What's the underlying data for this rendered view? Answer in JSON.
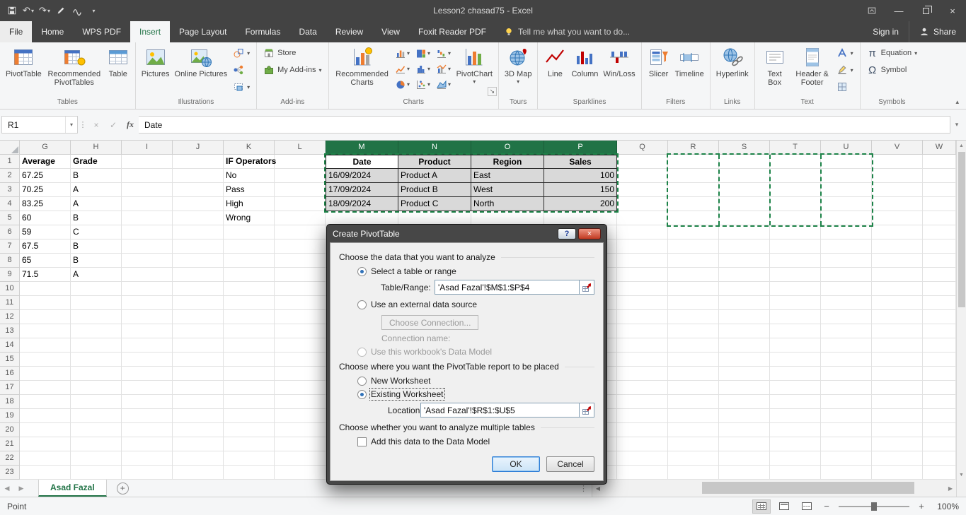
{
  "colors": {
    "accent_green": "#217346",
    "titlebar_bg": "#434343",
    "ribbon_bg": "#f5f6f7",
    "selected_header_bg": "#217346",
    "selection_fill": "#d9d9d9",
    "marching_ants_green": "#1d8348"
  },
  "icons": {
    "dropdown": "▾",
    "undo": "↶",
    "redo": "↷",
    "minimize": "—",
    "close": "×",
    "check": "✓",
    "cross": "×",
    "help": "?",
    "left": "◀",
    "right": "▶",
    "up": "▲",
    "down": "▼",
    "plus": "+",
    "minus": "−",
    "pi": "π",
    "omega": "Ω",
    "dots": "⋮",
    "launcher": "↘",
    "collapse": "▴"
  },
  "titlebar": {
    "title": "Lesson2 chasad75 - Excel"
  },
  "tabs": {
    "file": "File",
    "items": [
      "Home",
      "WPS PDF",
      "Insert",
      "Page Layout",
      "Formulas",
      "Data",
      "Review",
      "View",
      "Foxit Reader PDF"
    ],
    "active": "Insert",
    "tell_me": "Tell me what you want to do...",
    "sign_in": "Sign in",
    "share": "Share"
  },
  "ribbon": {
    "groups": {
      "tables": {
        "label": "Tables",
        "pivottable": "PivotTable",
        "recommended": "Recommended PivotTables",
        "table": "Table"
      },
      "illustrations": {
        "label": "Illustrations",
        "pictures": "Pictures",
        "online_pictures": "Online Pictures"
      },
      "addins": {
        "label": "Add-ins",
        "store": "Store",
        "my_addins": "My Add-ins"
      },
      "charts": {
        "label": "Charts",
        "recommended": "Recommended Charts",
        "pivotchart": "PivotChart"
      },
      "tours": {
        "label": "Tours",
        "map": "3D Map"
      },
      "sparklines": {
        "label": "Sparklines",
        "line": "Line",
        "column": "Column",
        "winloss": "Win/Loss"
      },
      "filters": {
        "label": "Filters",
        "slicer": "Slicer",
        "timeline": "Timeline"
      },
      "links": {
        "label": "Links",
        "hyperlink": "Hyperlink"
      },
      "text": {
        "label": "Text",
        "textbox": "Text Box",
        "headerfooter": "Header & Footer"
      },
      "symbols": {
        "label": "Symbols",
        "equation": "Equation",
        "symbol": "Symbol"
      }
    }
  },
  "formula_bar": {
    "name_box": "R1",
    "fx": "fx",
    "content": "Date"
  },
  "grid": {
    "columns": [
      "G",
      "H",
      "I",
      "J",
      "K",
      "L",
      "M",
      "N",
      "O",
      "P",
      "Q",
      "R",
      "S",
      "T",
      "U",
      "V",
      "W"
    ],
    "row_count": 23,
    "selected_columns": [
      "M",
      "N",
      "O",
      "P"
    ],
    "source_range": "M1:P4",
    "destination_range": "R1:U5",
    "cells": {
      "G1": "Average",
      "H1": "Grade",
      "K1": "IF Operators",
      "G2": "67.25",
      "H2": "B",
      "K2": "No",
      "G3": "70.25",
      "H3": "A",
      "K3": "Pass",
      "G4": "83.25",
      "H4": "A",
      "K4": "High",
      "G5": "60",
      "H5": "B",
      "K5": "Wrong",
      "G6": "59",
      "H6": "C",
      "G7": "67.5",
      "H7": "B",
      "G8": "65",
      "H8": "B",
      "G9": "71.5",
      "H9": "A",
      "M1": "Date",
      "N1": "Product",
      "O1": "Region",
      "P1": "Sales",
      "M2": "16/09/2024",
      "N2": "Product A",
      "O2": "East",
      "P2": "100",
      "M3": "17/09/2024",
      "N3": "Product B",
      "O3": "West",
      "P3": "150",
      "M4": "18/09/2024",
      "N4": "Product C",
      "O4": "North",
      "P4": "200"
    }
  },
  "dialog": {
    "title": "Create PivotTable",
    "section_analyze": "Choose the data that you want to analyze",
    "radio_select_range": "Select a table or range",
    "table_range_label": "Table/Range:",
    "table_range_value": "'Asad Fazal'!$M$1:$P$4",
    "radio_external": "Use an external data source",
    "choose_connection": "Choose Connection...",
    "connection_name": "Connection name:",
    "radio_data_model": "Use this workbook's Data Model",
    "section_place": "Choose where you want the PivotTable report to be placed",
    "radio_new_ws": "New Worksheet",
    "radio_existing_ws": "Existing Worksheet",
    "location_label": "Location:",
    "location_value": "'Asad Fazal'!$R$1:$U$5",
    "section_multiple": "Choose whether you want to analyze multiple tables",
    "checkbox_data_model": "Add this data to the Data Model",
    "ok": "OK",
    "cancel": "Cancel"
  },
  "sheet_bar": {
    "active_tab": "Asad Fazal"
  },
  "status_bar": {
    "mode": "Point",
    "zoom_level": "100%"
  }
}
